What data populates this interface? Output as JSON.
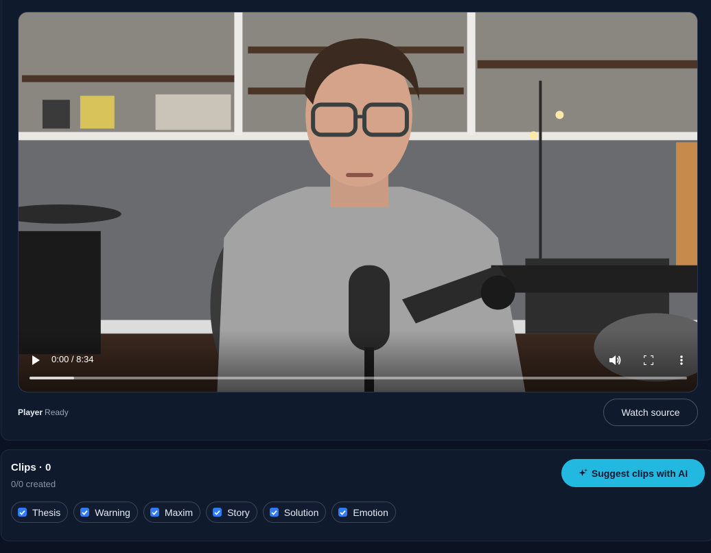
{
  "player": {
    "current_time": "0:00",
    "duration": "8:34",
    "time_display": "0:00 / 8:34",
    "buffered_fraction": 0.068,
    "status_label": "Player",
    "status_value": "Ready",
    "watch_source_label": "Watch source"
  },
  "clips": {
    "title": "Clips · 0",
    "created": "0/0 created",
    "suggest_label": "Suggest clips with AI",
    "filters": [
      {
        "label": "Thesis",
        "checked": true
      },
      {
        "label": "Warning",
        "checked": true
      },
      {
        "label": "Maxim",
        "checked": true
      },
      {
        "label": "Story",
        "checked": true
      },
      {
        "label": "Solution",
        "checked": true
      },
      {
        "label": "Emotion",
        "checked": true
      }
    ]
  },
  "colors": {
    "background": "#0b1221",
    "panel": "#0f1a2d",
    "accent": "#22b8e0",
    "checkbox": "#2f7cf6"
  }
}
